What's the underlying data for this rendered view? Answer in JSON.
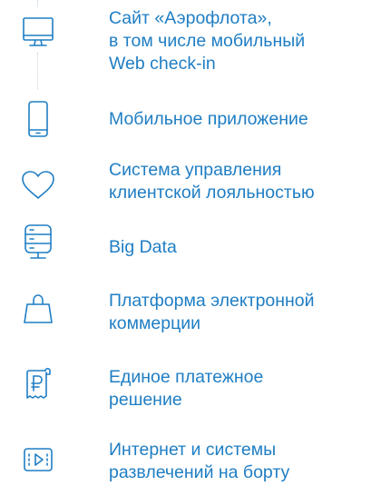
{
  "items": [
    {
      "icon": "desktop-computer-icon",
      "lines": [
        "Сайт «Аэрофлота»,",
        "в том числе мобильный",
        "Web check-in"
      ]
    },
    {
      "icon": "mobile-phone-icon",
      "lines": [
        "Мобильное приложение"
      ]
    },
    {
      "icon": "heart-icon",
      "lines": [
        "Система управления",
        "клиентской лояльностью"
      ]
    },
    {
      "icon": "database-server-icon",
      "lines": [
        "Big Data"
      ]
    },
    {
      "icon": "shopping-bag-icon",
      "lines": [
        "Платформа электронной",
        "коммерции"
      ]
    },
    {
      "icon": "ruble-receipt-icon",
      "lines": [
        "Единое платежное",
        "решение"
      ]
    },
    {
      "icon": "video-play-icon",
      "lines": [
        "Интернет и системы",
        "развлечений на борту"
      ]
    }
  ],
  "colors": {
    "accent": "#1f7ec4",
    "connector": "#c9d7e3"
  }
}
